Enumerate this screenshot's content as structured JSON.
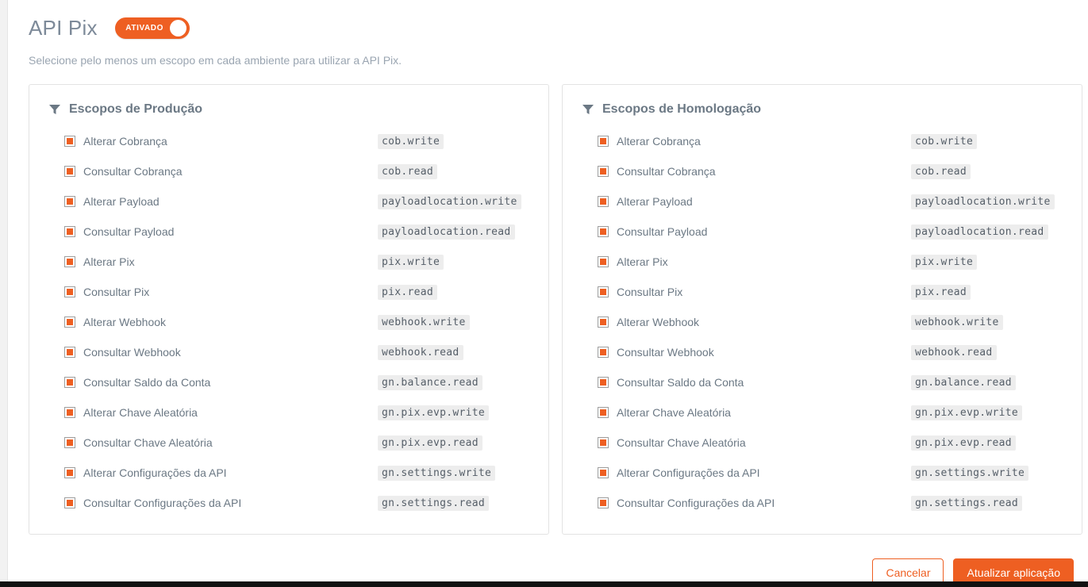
{
  "header": {
    "title": "API Pix",
    "toggle": {
      "label": "ATIVADO",
      "state": "on",
      "color": "#ee5f22"
    },
    "subtitle": "Selecione pelo menos um escopo em cada ambiente para utilizar a API Pix."
  },
  "panels": [
    {
      "id": "producao",
      "icon": "filter-icon",
      "title": "Escopos de Produção",
      "scopes": [
        {
          "label": "Alterar Cobrança",
          "code": "cob.write",
          "checked": true
        },
        {
          "label": "Consultar Cobrança",
          "code": "cob.read",
          "checked": true
        },
        {
          "label": "Alterar Payload",
          "code": "payloadlocation.write",
          "checked": true
        },
        {
          "label": "Consultar Payload",
          "code": "payloadlocation.read",
          "checked": true
        },
        {
          "label": "Alterar Pix",
          "code": "pix.write",
          "checked": true
        },
        {
          "label": "Consultar Pix",
          "code": "pix.read",
          "checked": true
        },
        {
          "label": "Alterar Webhook",
          "code": "webhook.write",
          "checked": true
        },
        {
          "label": "Consultar Webhook",
          "code": "webhook.read",
          "checked": true
        },
        {
          "label": "Consultar Saldo da Conta",
          "code": "gn.balance.read",
          "checked": true
        },
        {
          "label": "Alterar Chave Aleatória",
          "code": "gn.pix.evp.write",
          "checked": true
        },
        {
          "label": "Consultar Chave Aleatória",
          "code": "gn.pix.evp.read",
          "checked": true
        },
        {
          "label": "Alterar Configurações da API",
          "code": "gn.settings.write",
          "checked": true
        },
        {
          "label": "Consultar Configurações da API",
          "code": "gn.settings.read",
          "checked": true
        }
      ]
    },
    {
      "id": "homologacao",
      "icon": "filter-icon",
      "title": "Escopos de Homologação",
      "scopes": [
        {
          "label": "Alterar Cobrança",
          "code": "cob.write",
          "checked": true
        },
        {
          "label": "Consultar Cobrança",
          "code": "cob.read",
          "checked": true
        },
        {
          "label": "Alterar Payload",
          "code": "payloadlocation.write",
          "checked": true
        },
        {
          "label": "Consultar Payload",
          "code": "payloadlocation.read",
          "checked": true
        },
        {
          "label": "Alterar Pix",
          "code": "pix.write",
          "checked": true
        },
        {
          "label": "Consultar Pix",
          "code": "pix.read",
          "checked": true
        },
        {
          "label": "Alterar Webhook",
          "code": "webhook.write",
          "checked": true
        },
        {
          "label": "Consultar Webhook",
          "code": "webhook.read",
          "checked": true
        },
        {
          "label": "Consultar Saldo da Conta",
          "code": "gn.balance.read",
          "checked": true
        },
        {
          "label": "Alterar Chave Aleatória",
          "code": "gn.pix.evp.write",
          "checked": true
        },
        {
          "label": "Consultar Chave Aleatória",
          "code": "gn.pix.evp.read",
          "checked": true
        },
        {
          "label": "Alterar Configurações da API",
          "code": "gn.settings.write",
          "checked": true
        },
        {
          "label": "Consultar Configurações da API",
          "code": "gn.settings.read",
          "checked": true
        }
      ]
    }
  ],
  "footer": {
    "cancel_label": "Cancelar",
    "submit_label": "Atualizar aplicação"
  },
  "colors": {
    "accent": "#ee5f22",
    "text": "#6b7884",
    "muted": "#9aa5b1",
    "code_bg": "#ededed",
    "panel_border": "#e3e3e3"
  }
}
